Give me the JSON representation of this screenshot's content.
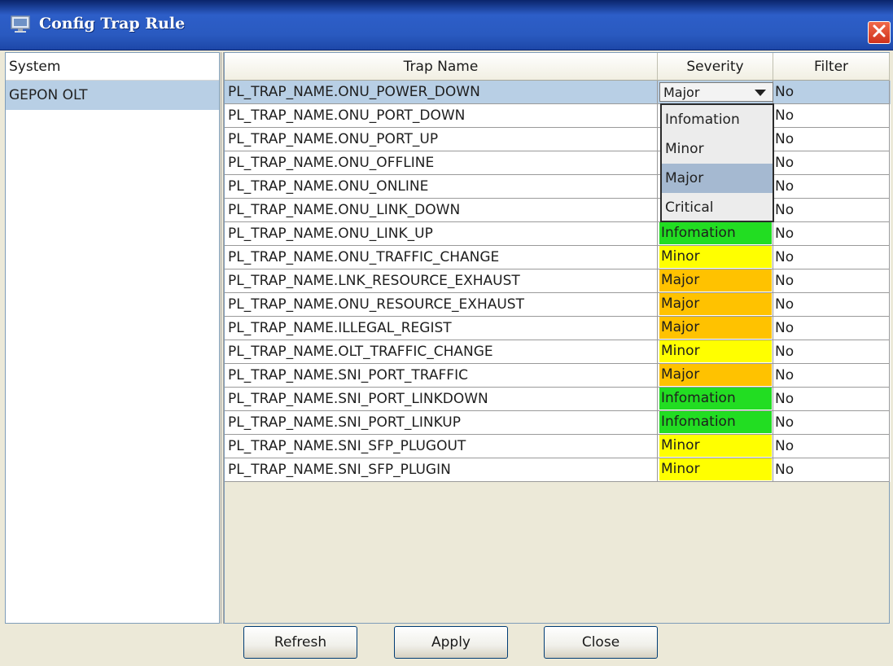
{
  "window": {
    "title": "Config Trap Rule"
  },
  "colors": {
    "Infomation": "#22dd22",
    "Minor": "#ffff00",
    "Major": "#ffc200",
    "selected_row": "#b8cfe5"
  },
  "left_panel": {
    "header": "System",
    "items": [
      "GEPON OLT"
    ]
  },
  "table": {
    "columns": [
      "Trap Name",
      "Severity",
      "Filter"
    ],
    "rows": [
      {
        "name": "PL_TRAP_NAME.ONU_POWER_DOWN",
        "severity": "Major",
        "filter": "No"
      },
      {
        "name": "PL_TRAP_NAME.ONU_PORT_DOWN",
        "severity": "",
        "filter": "No"
      },
      {
        "name": "PL_TRAP_NAME.ONU_PORT_UP",
        "severity": "",
        "filter": "No"
      },
      {
        "name": "PL_TRAP_NAME.ONU_OFFLINE",
        "severity": "",
        "filter": "No"
      },
      {
        "name": "PL_TRAP_NAME.ONU_ONLINE",
        "severity": "",
        "filter": "No"
      },
      {
        "name": "PL_TRAP_NAME.ONU_LINK_DOWN",
        "severity": "",
        "filter": "No"
      },
      {
        "name": "PL_TRAP_NAME.ONU_LINK_UP",
        "severity": "Infomation",
        "filter": "No"
      },
      {
        "name": "PL_TRAP_NAME.ONU_TRAFFIC_CHANGE",
        "severity": "Minor",
        "filter": "No"
      },
      {
        "name": "PL_TRAP_NAME.LNK_RESOURCE_EXHAUST",
        "severity": "Major",
        "filter": "No"
      },
      {
        "name": "PL_TRAP_NAME.ONU_RESOURCE_EXHAUST",
        "severity": "Major",
        "filter": "No"
      },
      {
        "name": "PL_TRAP_NAME.ILLEGAL_REGIST",
        "severity": "Major",
        "filter": "No"
      },
      {
        "name": "PL_TRAP_NAME.OLT_TRAFFIC_CHANGE",
        "severity": "Minor",
        "filter": "No"
      },
      {
        "name": "PL_TRAP_NAME.SNI_PORT_TRAFFIC",
        "severity": "Major",
        "filter": "No"
      },
      {
        "name": "PL_TRAP_NAME.SNI_PORT_LINKDOWN",
        "severity": "Infomation",
        "filter": "No"
      },
      {
        "name": "PL_TRAP_NAME.SNI_PORT_LINKUP",
        "severity": "Infomation",
        "filter": "No"
      },
      {
        "name": "PL_TRAP_NAME.SNI_SFP_PLUGOUT",
        "severity": "Minor",
        "filter": "No"
      },
      {
        "name": "PL_TRAP_NAME.SNI_SFP_PLUGIN",
        "severity": "Minor",
        "filter": "No"
      }
    ]
  },
  "severity_combo": {
    "selected": "Major",
    "options": [
      "Infomation",
      "Minor",
      "Major",
      "Critical"
    ]
  },
  "buttons": {
    "refresh": "Refresh",
    "apply": "Apply",
    "close": "Close"
  },
  "icons": {
    "title": "computer-monitor-icon",
    "close": "close-icon",
    "dropdown": "chevron-down-icon"
  }
}
